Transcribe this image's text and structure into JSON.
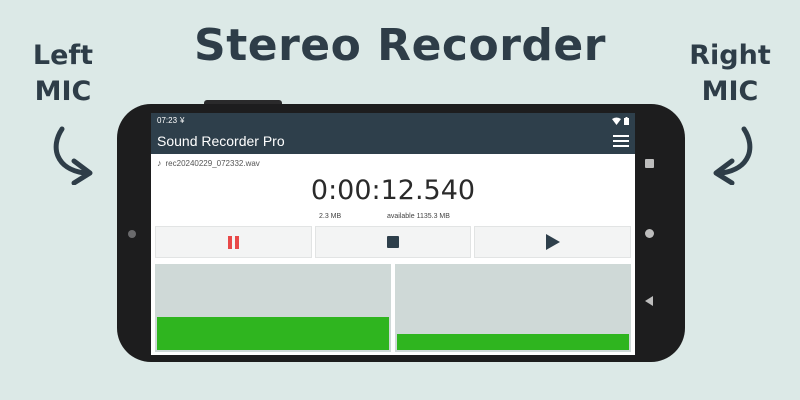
{
  "banner": {
    "title": "Stereo Recorder",
    "left_label_line1": "Left",
    "left_label_line2": "MIC",
    "right_label_line1": "Right",
    "right_label_line2": "MIC"
  },
  "statusbar": {
    "time": "07:23",
    "notification_icon": "download-icon",
    "wifi_icon": "wifi-icon",
    "battery_icon": "battery-icon"
  },
  "appbar": {
    "title": "Sound Recorder Pro",
    "menu_icon": "hamburger-menu-icon"
  },
  "recording": {
    "filename": "rec20240229_072332.wav",
    "elapsed": "0:00:12.540",
    "file_size": "2.3 MB",
    "available": "available 1135.3 MB"
  },
  "controls": {
    "pause_icon": "pause-icon",
    "stop_icon": "stop-icon",
    "play_icon": "play-icon"
  },
  "meters": {
    "left_level": 0.4,
    "right_level": 0.2,
    "fill_color": "#2fb51f",
    "track_color": "#cfd9d7"
  },
  "colors": {
    "background": "#dce9e7",
    "appbar": "#2e3f4b",
    "pause": "#e84848"
  }
}
